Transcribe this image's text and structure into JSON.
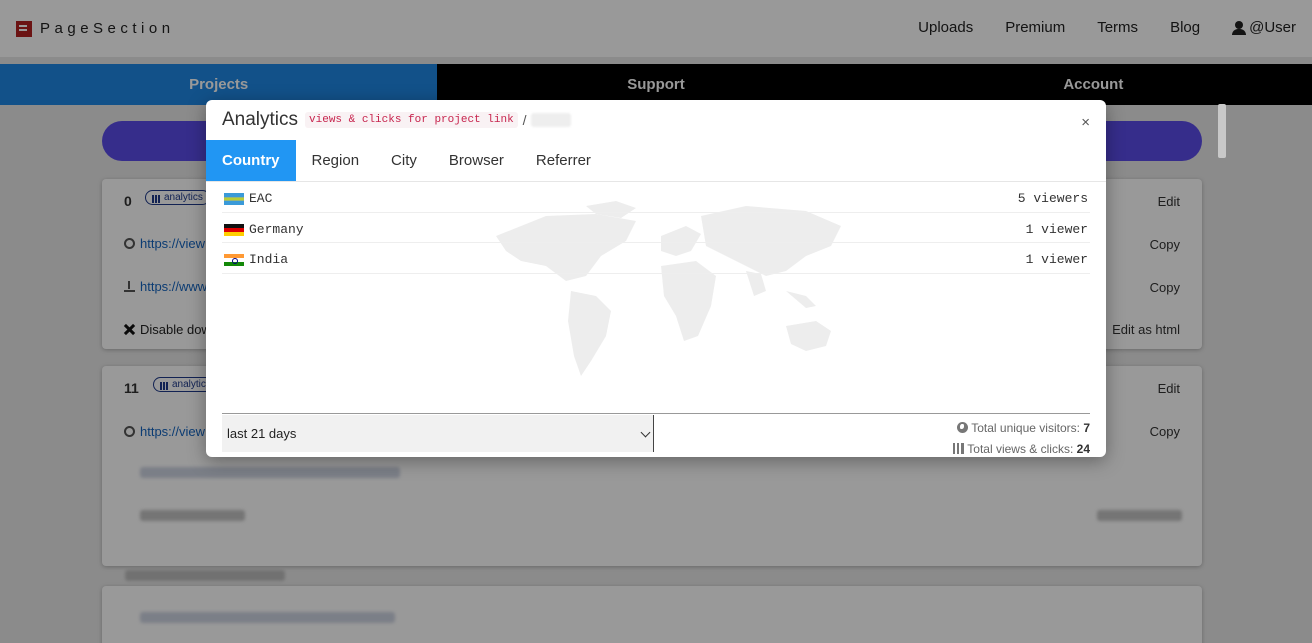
{
  "brand": {
    "name": "PageSection"
  },
  "topnav": {
    "uploads": "Uploads",
    "premium": "Premium",
    "terms": "Terms",
    "blog": "Blog",
    "user": "@User"
  },
  "tabs": {
    "projects": "Projects",
    "support": "Support",
    "account": "Account"
  },
  "cards": [
    {
      "count": "0",
      "badge": "analytics",
      "edit": "Edit",
      "view_link": "https://view",
      "download_link": "https://www",
      "copy": "Copy",
      "disable": "Disable dow",
      "edit_html": "Edit as html"
    },
    {
      "count": "11",
      "badge": "analytic",
      "edit": "Edit",
      "view_link": "https://view",
      "copy": "Copy"
    }
  ],
  "modal": {
    "title": "Analytics",
    "subtitle": "views & clicks for project link",
    "slash": "/",
    "close": "×",
    "tabs": [
      "Country",
      "Region",
      "City",
      "Browser",
      "Referrer"
    ],
    "active_tab": "Country",
    "rows": [
      {
        "country": "EAC",
        "count": "5 viewers"
      },
      {
        "country": "Germany",
        "count": "1 viewer"
      },
      {
        "country": "India",
        "count": "1 viewer"
      }
    ],
    "range": "last 21 days",
    "total_visitors_label": "Total unique visitors:",
    "total_visitors": "7",
    "total_views_label": "Total views & clicks:",
    "total_views": "24"
  },
  "colors": {
    "accent": "#2196f3",
    "tab_active": "#1e88e5",
    "nav_bg": "#000000",
    "button": "#5b4ce8"
  }
}
